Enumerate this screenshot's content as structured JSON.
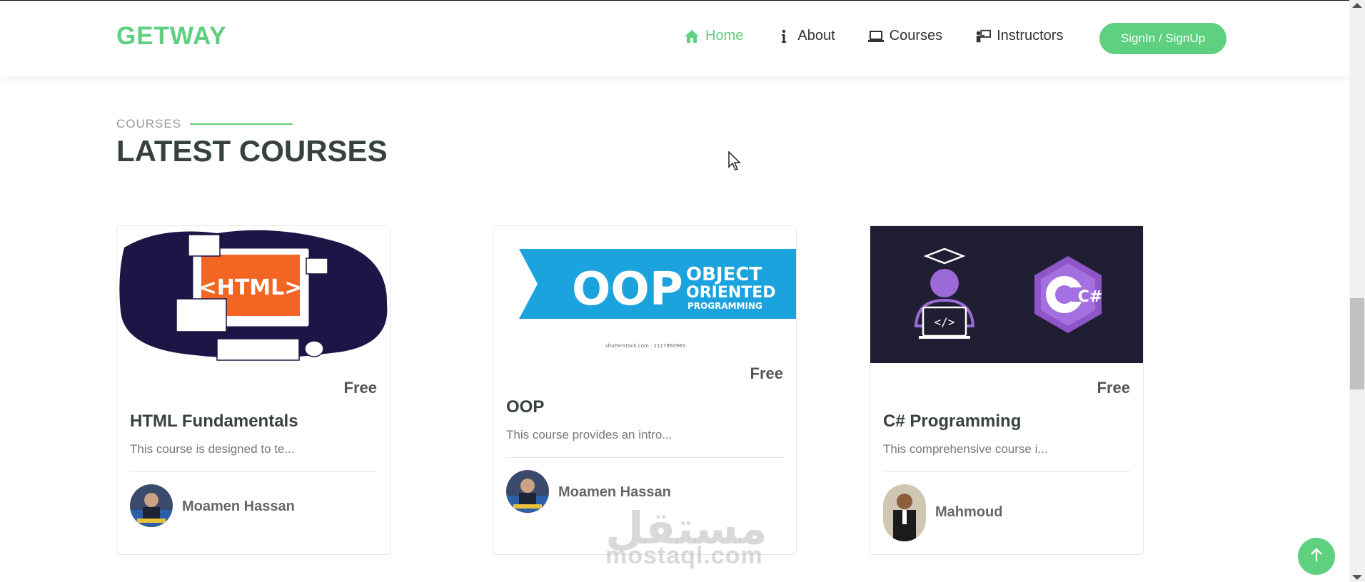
{
  "header": {
    "logo": "GETWAY",
    "nav": [
      {
        "label": "Home",
        "icon": "home-icon",
        "active": true
      },
      {
        "label": "About",
        "icon": "info-icon",
        "active": false
      },
      {
        "label": "Courses",
        "icon": "laptop-icon",
        "active": false
      },
      {
        "label": "Instructors",
        "icon": "instructor-icon",
        "active": false
      }
    ],
    "signin_label": "SignIn / SignUp"
  },
  "section": {
    "label": "COURSES",
    "title": "LATEST COURSES"
  },
  "courses": [
    {
      "price": "Free",
      "title": "HTML Fundamentals",
      "desc": "This course is designed to te...",
      "instructor": "Moamen Hassan",
      "image_text": "<HTML>"
    },
    {
      "price": "Free",
      "title": "OOP",
      "desc": "This course provides an intro...",
      "instructor": "Moamen Hassan",
      "image_text_big": "OOP",
      "image_text_l1": "OBJECT",
      "image_text_l2": "ORIENTED",
      "image_text_l3": "PROGRAMMING",
      "image_caption": "shutterstock.com · 2117950965"
    },
    {
      "price": "Free",
      "title": "C# Programming",
      "desc": "This comprehensive course i...",
      "instructor": "Mahmoud",
      "image_text": "C#"
    }
  ],
  "watermark": {
    "arabic": "مستقل",
    "latin": "mostaql.com"
  },
  "colors": {
    "brand": "#5fcf80",
    "heading": "#37423b"
  }
}
